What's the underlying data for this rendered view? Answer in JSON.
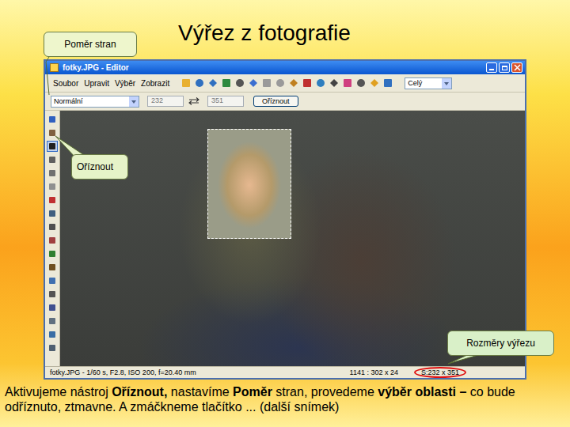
{
  "slide": {
    "title": "Výřez z fotografie"
  },
  "callouts": [
    {
      "label": "Poměr stran"
    },
    {
      "label": "Oříznout"
    },
    {
      "label": "Rozměry výřezu"
    }
  ],
  "window": {
    "title": "fotky.JPG - Editor"
  },
  "menu": [
    "Soubor",
    "Upravit",
    "Výběr",
    "Zobrazit"
  ],
  "toolbar": {
    "view": "Celý"
  },
  "crop_bar": {
    "ratio": "Normální",
    "width": "232",
    "height": "351",
    "button": "Oříznout"
  },
  "tools": [
    {
      "selected": false
    },
    {
      "selected": false
    },
    {
      "selected": true
    },
    {
      "selected": false
    },
    {
      "selected": false
    },
    {
      "selected": false
    },
    {
      "selected": false
    },
    {
      "selected": false
    },
    {
      "selected": false
    },
    {
      "selected": false
    },
    {
      "selected": false
    },
    {
      "selected": false
    },
    {
      "selected": false
    },
    {
      "selected": false
    },
    {
      "selected": false
    },
    {
      "selected": false
    },
    {
      "selected": false
    },
    {
      "selected": false
    }
  ],
  "status_bar": {
    "info": "fotky.JPG - 1/60 s, F2.8, ISO 200, f=20.40 mm",
    "position": "1141 : 302 x 24",
    "selection": "S:232 x 351"
  },
  "caption": [
    {
      "text": "Aktivujeme nástroj ",
      "bold": false
    },
    {
      "text": "Oříznout,",
      "bold": true
    },
    {
      "text": " nastavíme ",
      "bold": false
    },
    {
      "text": "Poměr",
      "bold": true
    },
    {
      "text": " stran, provedeme ",
      "bold": false
    },
    {
      "text": "výběr oblasti –",
      "bold": true
    },
    {
      "text": " co bude odříznuto, ztmavne. A zmáčkneme tlačítko ... (další snímek)",
      "bold": false
    }
  ]
}
